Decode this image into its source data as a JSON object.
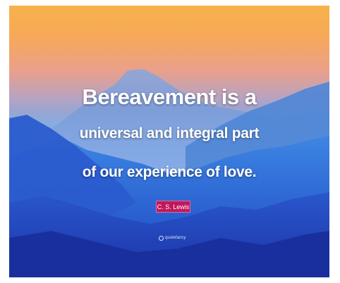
{
  "quote": {
    "line1": "Bereavement is a",
    "line2": "universal and integral part",
    "line3": "of our experience of love."
  },
  "author": "C. S. Lewis",
  "brand": "quotefancy",
  "colors": {
    "sky_top": "#f6b24a",
    "sky_mid": "#e9a08c",
    "mountain_far": "#6f95d6",
    "mountain_mid": "#2f6fd8",
    "mountain_near": "#1f3fb8",
    "author_badge": "#c2185b",
    "text": "#ffffff"
  }
}
